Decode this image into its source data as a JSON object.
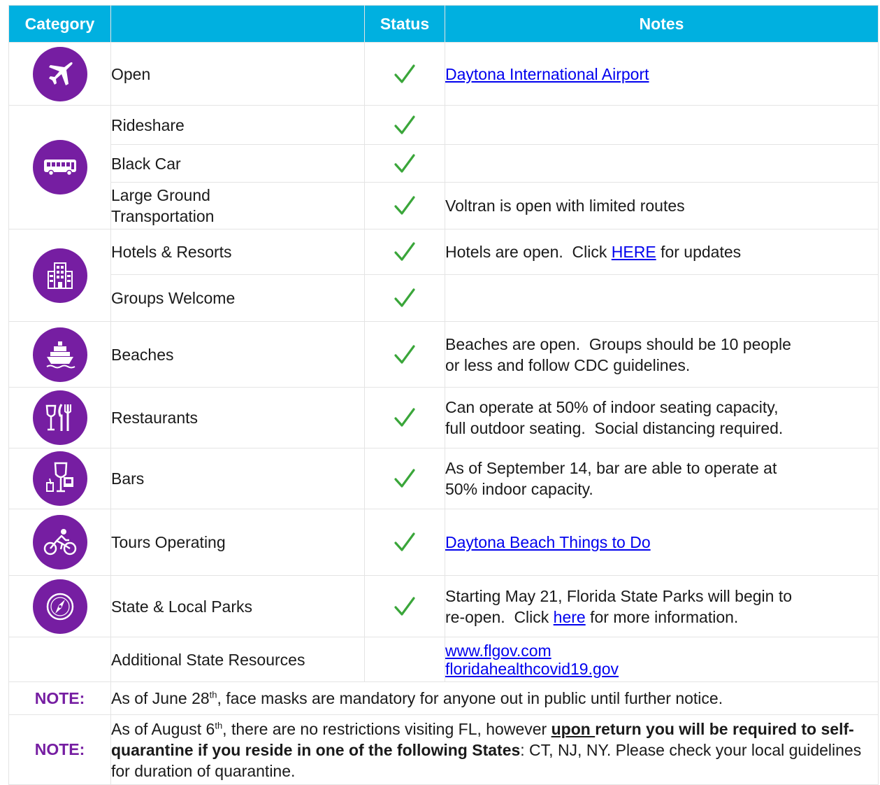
{
  "headers": {
    "category": "Category",
    "blank": "",
    "status": "Status",
    "notes": "Notes"
  },
  "colors": {
    "header_bg": "#00b0e0",
    "icon_circle": "#761ea2",
    "check": "#3aa63a",
    "note_label": "#761ea2",
    "link": "#0000ee"
  },
  "rows": {
    "airport": {
      "icon": "airplane-icon",
      "label": "Open",
      "status": "check",
      "link": "Daytona International Airport"
    },
    "rideshare": {
      "icon": "bus-icon",
      "label": "Rideshare",
      "status": "check"
    },
    "blackcar": {
      "label": "Black Car",
      "status": "check"
    },
    "ground": {
      "label_line1": "Large Ground",
      "label_line2": "Transportation",
      "status": "check",
      "notes": "Voltran is open with limited routes"
    },
    "hotels": {
      "icon": "building-icon",
      "label": "Hotels & Resorts",
      "status": "check",
      "notes_before": "Hotels are open.  Click ",
      "notes_link": "HERE",
      "notes_after": " for updates"
    },
    "groups": {
      "label": "Groups Welcome",
      "status": "check"
    },
    "beaches": {
      "icon": "cruise-ship-icon",
      "label": "Beaches",
      "status": "check",
      "notes_line1": "Beaches are open.  Groups should be 10 people",
      "notes_line2": "or less and follow CDC guidelines."
    },
    "restaurants": {
      "icon": "dining-icon",
      "label": "Restaurants",
      "status": "check",
      "notes_line1": "Can operate at 50% of indoor seating capacity,",
      "notes_line2": "full outdoor seating.  Social distancing required."
    },
    "bars": {
      "icon": "drinks-icon",
      "label": "Bars",
      "status": "check",
      "notes_line1": "As of September 14, bar are able to operate at",
      "notes_line2": "50% indoor capacity."
    },
    "tours": {
      "icon": "bicycle-icon",
      "label": "Tours Operating",
      "status": "check",
      "link": "Daytona Beach Things to Do"
    },
    "parks": {
      "icon": "compass-icon",
      "label": "State & Local Parks",
      "status": "check",
      "notes_line1": "Starting May 21, Florida State Parks will begin to",
      "notes_line2_before": "re-open.  Click ",
      "notes_link": "here",
      "notes_line2_after": " for more information."
    },
    "resources": {
      "label": "Additional State Resources",
      "link1": "www.flgov.com",
      "link2": "floridahealthcovid19.gov"
    }
  },
  "notes": {
    "note1": {
      "label": "NOTE:",
      "text_before": "As of June 28",
      "sup": "th",
      "text_after": ", face masks are mandatory for anyone out in public until further notice."
    },
    "note2": {
      "label": "NOTE:",
      "text_before": "As of August 6",
      "sup": "th",
      "text_mid": ", there are no restrictions visiting FL, however ",
      "bold_underline": "upon ",
      "bold1": "return you will be required to self-quarantine if you reside in one of the following States",
      "text_end": ": CT, NJ, NY. Please check your local guidelines for duration of quarantine."
    }
  }
}
